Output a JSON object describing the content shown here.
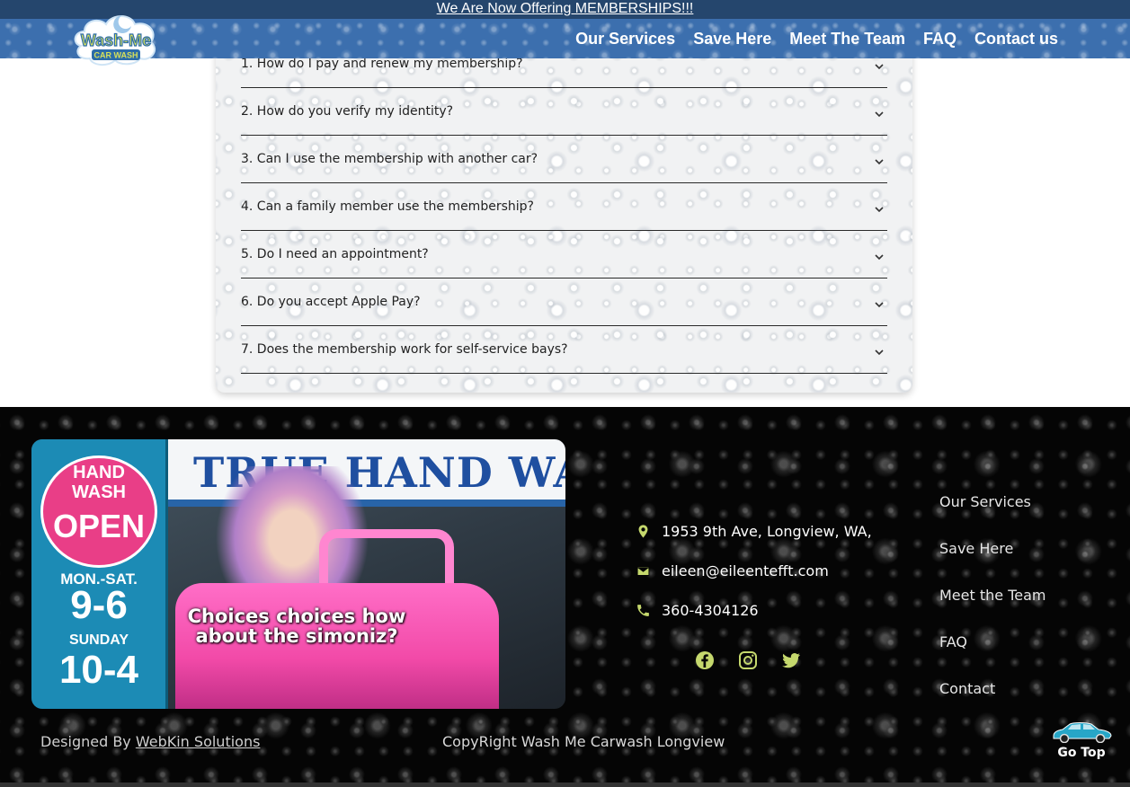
{
  "announcement": {
    "text": "We Are Now Offering MEMBERSHIPS!!!"
  },
  "logo": {
    "line1": "Wash-Me",
    "line2": "CAR WASH"
  },
  "nav": {
    "items": [
      "Our Services",
      "Save Here",
      "Meet The Team",
      "FAQ",
      "Contact us"
    ]
  },
  "faq": {
    "questions": [
      "1. How do I pay and renew my membership?",
      "2. How do you verify my identity?",
      "3. Can I use the membership with another car?",
      "4. Can a family member use the membership?",
      "5. Do I need an appointment?",
      "6. Do you accept Apple Pay?",
      "7. Does the membership work for self-service bays?"
    ]
  },
  "photo": {
    "banner": "TRUE HAND WASH",
    "sign": {
      "line1": "HAND",
      "line2": "WASH",
      "line3": "OPEN",
      "days1": "MON.-SAT.",
      "hours1": "9-6",
      "days2": "SUNDAY",
      "hours2": "10-4"
    },
    "caption": "Choices choices how about the simoniz?"
  },
  "contact": {
    "address": "1953 9th Ave, Longview, WA,",
    "email": "eileen@eileentefft.com",
    "phone": "360-4304126"
  },
  "social": [
    "facebook-icon",
    "instagram-icon",
    "twitter-icon"
  ],
  "footer_links": [
    "Our Services",
    "Save Here",
    "Meet the Team",
    "FAQ",
    "Contact"
  ],
  "designed_by": {
    "prefix": "Designed By ",
    "link": "WebKin Solutions"
  },
  "copyright": "CopyRight Wash Me Carwash Longview",
  "go_top": "Go Top",
  "colors": {
    "announce_bg": "#25466d",
    "nav_bg": "#3c6fae",
    "icon_green": "#c5d86d",
    "footer_bg": "#050505"
  }
}
